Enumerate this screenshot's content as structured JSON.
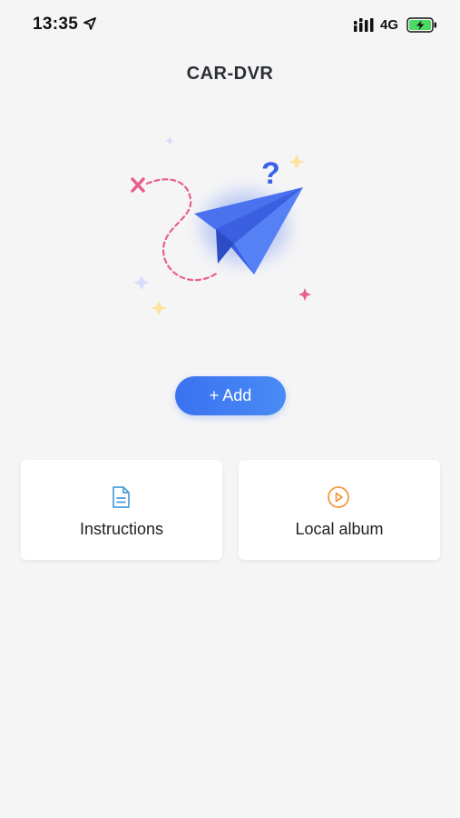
{
  "status_bar": {
    "time": "13:35",
    "network": "4G",
    "icons": [
      "location-arrow-icon",
      "signal-icon",
      "battery-charging-icon"
    ]
  },
  "header": {
    "title": "CAR-DVR"
  },
  "illustration": {
    "icon": "paper-plane-icon"
  },
  "actions": {
    "add_label": "+ Add"
  },
  "cards": [
    {
      "label": "Instructions",
      "icon": "document-icon",
      "color": "#4a9fd8"
    },
    {
      "label": "Local album",
      "icon": "play-circle-icon",
      "color": "#f09a3e"
    }
  ],
  "colors": {
    "accent": "#3a72f0",
    "background": "#f5f5f6"
  }
}
